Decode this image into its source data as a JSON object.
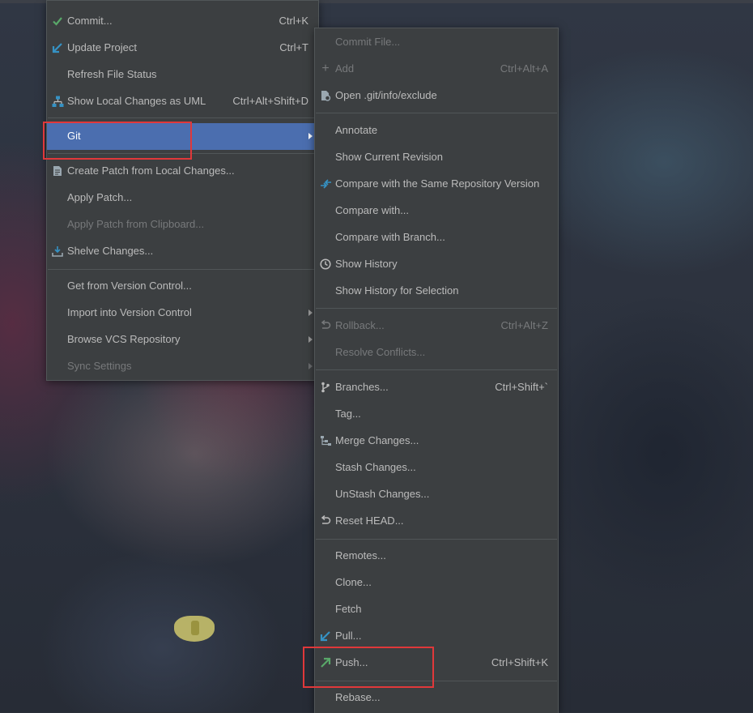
{
  "colors": {
    "menu_bg": "#3c3f41",
    "selected_bg": "#4b6eaf",
    "text": "#bbbbbb",
    "disabled_text": "#77797b",
    "highlight_box": "#e0383a",
    "check_green": "#59a869",
    "arrow_blue": "#3592c4"
  },
  "main_menu": {
    "items": [
      {
        "label": "Commit...",
        "shortcut": "Ctrl+K",
        "icon": "green-check-icon"
      },
      {
        "label": "Update Project",
        "shortcut": "Ctrl+T",
        "icon": "blue-arrow-icon"
      },
      {
        "label": "Refresh File Status",
        "shortcut": "",
        "icon": ""
      },
      {
        "label": "Show Local Changes as UML",
        "shortcut": "Ctrl+Alt+Shift+D",
        "icon": "diagram-icon"
      },
      {
        "label": "Git",
        "shortcut": "",
        "icon": "",
        "submenu": true,
        "selected": true
      },
      {
        "label": "Create Patch from Local Changes...",
        "shortcut": "",
        "icon": "patch-file-icon"
      },
      {
        "label": "Apply Patch...",
        "shortcut": "",
        "icon": ""
      },
      {
        "label": "Apply Patch from Clipboard...",
        "shortcut": "",
        "icon": "",
        "disabled": true
      },
      {
        "label": "Shelve Changes...",
        "shortcut": "",
        "icon": "shelve-icon"
      },
      {
        "label": "Get from Version Control...",
        "shortcut": "",
        "icon": ""
      },
      {
        "label": "Import into Version Control",
        "shortcut": "",
        "icon": "",
        "submenu": true
      },
      {
        "label": "Browse VCS Repository",
        "shortcut": "",
        "icon": "",
        "submenu": true
      },
      {
        "label": "Sync Settings",
        "shortcut": "",
        "icon": "",
        "submenu": true,
        "disabled": true
      }
    ]
  },
  "git_menu": {
    "items": [
      {
        "label": "Commit File...",
        "shortcut": "",
        "icon": "",
        "disabled": true
      },
      {
        "label": "Add",
        "shortcut": "Ctrl+Alt+A",
        "icon": "plus-icon",
        "disabled": true
      },
      {
        "label": "Open .git/info/exclude",
        "shortcut": "",
        "icon": "file-settings-icon"
      },
      {
        "label": "Annotate",
        "shortcut": "",
        "icon": ""
      },
      {
        "label": "Show Current Revision",
        "shortcut": "",
        "icon": ""
      },
      {
        "label": "Compare with the Same Repository Version",
        "shortcut": "",
        "icon": "compare-arrows-icon"
      },
      {
        "label": "Compare with...",
        "shortcut": "",
        "icon": ""
      },
      {
        "label": "Compare with Branch...",
        "shortcut": "",
        "icon": ""
      },
      {
        "label": "Show History",
        "shortcut": "",
        "icon": "clock-icon"
      },
      {
        "label": "Show History for Selection",
        "shortcut": "",
        "icon": ""
      },
      {
        "label": "Rollback...",
        "shortcut": "Ctrl+Alt+Z",
        "icon": "rollback-icon",
        "disabled": true
      },
      {
        "label": "Resolve Conflicts...",
        "shortcut": "",
        "icon": "",
        "disabled": true
      },
      {
        "label": "Branches...",
        "shortcut": "Ctrl+Shift+`",
        "icon": "branch-icon"
      },
      {
        "label": "Tag...",
        "shortcut": "",
        "icon": ""
      },
      {
        "label": "Merge Changes...",
        "shortcut": "",
        "icon": "merge-icon"
      },
      {
        "label": "Stash Changes...",
        "shortcut": "",
        "icon": ""
      },
      {
        "label": "UnStash Changes...",
        "shortcut": "",
        "icon": ""
      },
      {
        "label": "Reset HEAD...",
        "shortcut": "",
        "icon": "reset-icon"
      },
      {
        "label": "Remotes...",
        "shortcut": "",
        "icon": ""
      },
      {
        "label": "Clone...",
        "shortcut": "",
        "icon": ""
      },
      {
        "label": "Fetch",
        "shortcut": "",
        "icon": ""
      },
      {
        "label": "Pull...",
        "shortcut": "",
        "icon": "pull-arrow-icon"
      },
      {
        "label": "Push...",
        "shortcut": "Ctrl+Shift+K",
        "icon": "push-arrow-icon"
      },
      {
        "label": "Rebase...",
        "shortcut": "",
        "icon": ""
      }
    ]
  }
}
